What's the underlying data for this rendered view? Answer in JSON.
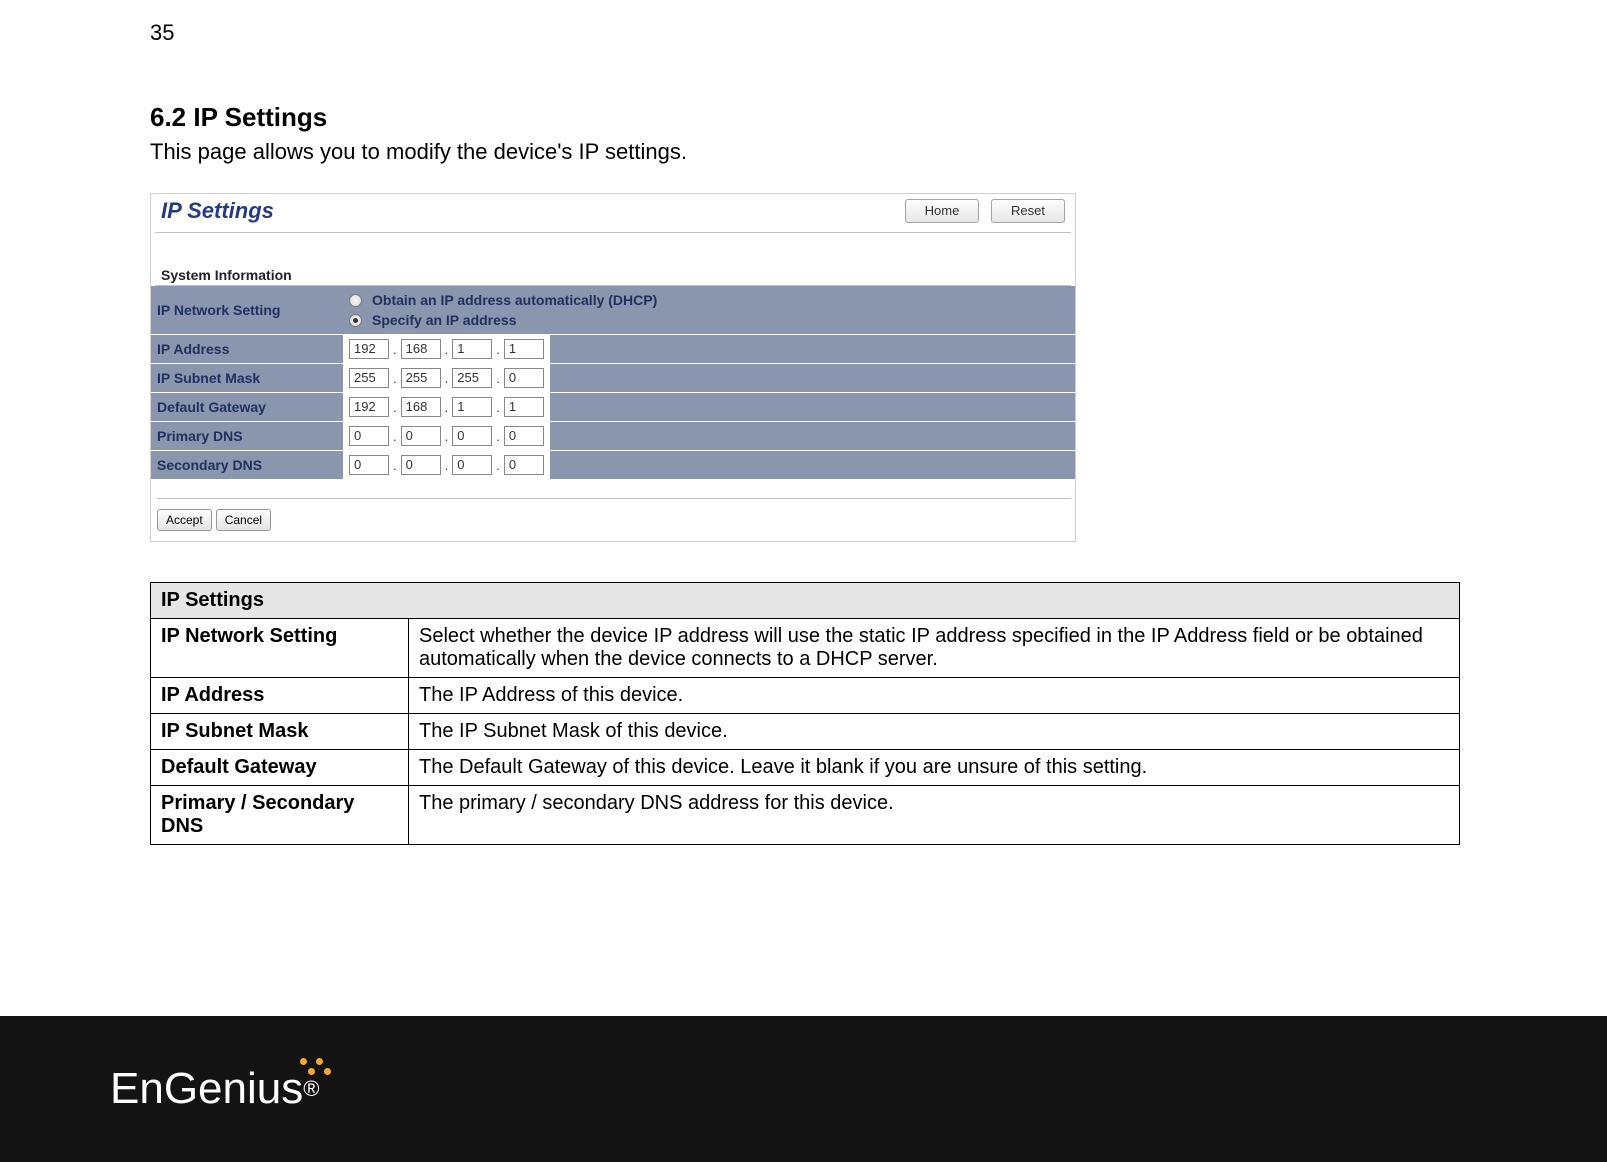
{
  "page_number": "35",
  "section_title": "6.2   IP Settings",
  "intro_text": "This page allows you to modify the device's IP settings.",
  "panel": {
    "title": "IP Settings",
    "home_label": "Home",
    "reset_label": "Reset",
    "system_info_label": "System Information",
    "rows": {
      "ip_network_label": "IP Network Setting",
      "opt_dhcp": "Obtain an IP address automatically (DHCP)",
      "opt_static": "Specify an IP address",
      "ip_address_label": "IP Address",
      "ip_address": [
        "192",
        "168",
        "1",
        "1"
      ],
      "subnet_label": "IP Subnet Mask",
      "subnet": [
        "255",
        "255",
        "255",
        "0"
      ],
      "gateway_label": "Default Gateway",
      "gateway": [
        "192",
        "168",
        "1",
        "1"
      ],
      "pdns_label": "Primary DNS",
      "pdns": [
        "0",
        "0",
        "0",
        "0"
      ],
      "sdns_label": "Secondary DNS",
      "sdns": [
        "0",
        "0",
        "0",
        "0"
      ]
    },
    "accept_label": "Accept",
    "cancel_label": "Cancel"
  },
  "desc": {
    "header": "IP Settings",
    "rows": [
      {
        "k": "IP Network Setting",
        "v": "Select whether the device IP address will use the static IP address specified in the IP Address field or be obtained automatically when the device connects to a DHCP server."
      },
      {
        "k": "IP Address",
        "v": "The IP Address of this device."
      },
      {
        "k": "IP Subnet Mask",
        "v": "The IP Subnet Mask of this device."
      },
      {
        "k": "Default Gateway",
        "v": "The Default Gateway of this device. Leave it blank if you are unsure of this setting."
      },
      {
        "k": "Primary / Secondary DNS",
        "v": "The primary / secondary DNS address for this device."
      }
    ]
  },
  "logo_text": "EnGenius",
  "logo_reg": "®"
}
